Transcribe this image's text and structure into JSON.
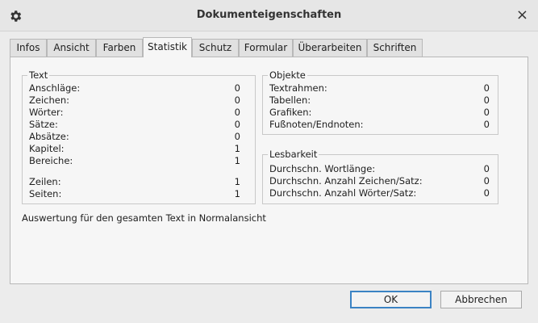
{
  "window": {
    "title": "Dokumenteigenschaften",
    "settings_icon": "gear-icon",
    "close_label": "×"
  },
  "tabs": [
    "Infos",
    "Ansicht",
    "Farben",
    "Statistik",
    "Schutz",
    "Formular",
    "Überarbeiten",
    "Schriften"
  ],
  "active_tab": "Statistik",
  "text_group": {
    "title": "Text",
    "rows": [
      {
        "label": "Anschläge:",
        "value": "0"
      },
      {
        "label": "Zeichen:",
        "value": "0"
      },
      {
        "label": "Wörter:",
        "value": "0"
      },
      {
        "label": "Sätze:",
        "value": "0"
      },
      {
        "label": "Absätze:",
        "value": "0"
      },
      {
        "label": "Kapitel:",
        "value": "1"
      },
      {
        "label": "Bereiche:",
        "value": "1"
      },
      {
        "label": "Zeilen:",
        "value": "1"
      },
      {
        "label": "Seiten:",
        "value": "1"
      }
    ]
  },
  "objects_group": {
    "title": "Objekte",
    "rows": [
      {
        "label": "Textrahmen:",
        "value": "0"
      },
      {
        "label": "Tabellen:",
        "value": "0"
      },
      {
        "label": "Grafiken:",
        "value": "0"
      },
      {
        "label": "Fußnoten/Endnoten:",
        "value": "0"
      }
    ]
  },
  "readability_group": {
    "title": "Lesbarkeit",
    "rows": [
      {
        "label": "Durchschn. Wortlänge:",
        "value": "0"
      },
      {
        "label": "Durchschn. Anzahl Zeichen/Satz:",
        "value": "0"
      },
      {
        "label": "Durchschn. Anzahl Wörter/Satz:",
        "value": "0"
      }
    ]
  },
  "note": "Auswertung für den gesamten Text in Normalansicht",
  "buttons": {
    "ok": "OK",
    "cancel": "Abbrechen"
  },
  "colors": {
    "accent": "#3b83c4",
    "panel": "#f6f6f6",
    "window": "#ececec"
  }
}
